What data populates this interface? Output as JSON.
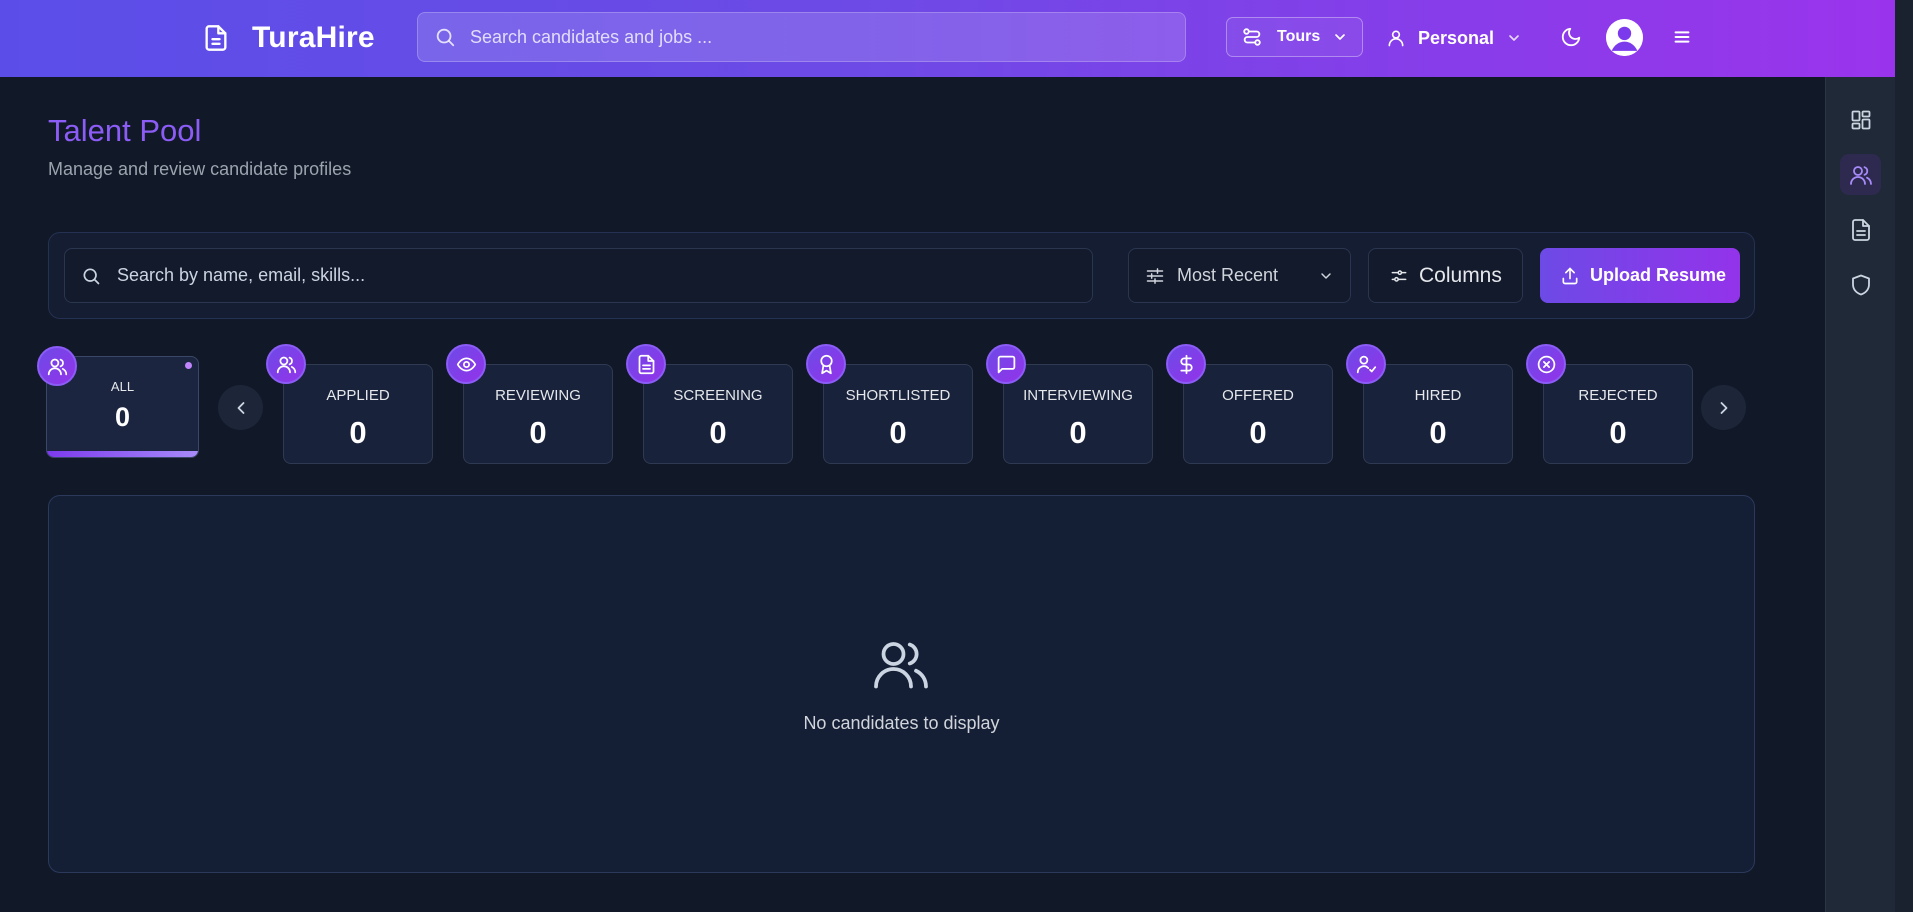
{
  "header": {
    "brand": "TuraHire",
    "search_placeholder": "Search candidates and jobs ...",
    "tours_label": "Tours",
    "workspace_label": "Personal"
  },
  "page": {
    "title": "Talent Pool",
    "subtitle": "Manage and review candidate profiles"
  },
  "toolbar": {
    "search_placeholder": "Search by name, email, skills...",
    "sort_value": "Most Recent",
    "columns_label": "Columns",
    "upload_label": "Upload Resume"
  },
  "statuses": {
    "all": {
      "label": "ALL",
      "count": "0",
      "icon": "users-icon"
    },
    "applied": {
      "label": "APPLIED",
      "count": "0",
      "icon": "users-icon"
    },
    "reviewing": {
      "label": "REVIEWING",
      "count": "0",
      "icon": "eye-icon"
    },
    "screening": {
      "label": "SCREENING",
      "count": "0",
      "icon": "document-icon"
    },
    "shortlisted": {
      "label": "SHORTLISTED",
      "count": "0",
      "icon": "award-icon"
    },
    "interviewing": {
      "label": "INTERVIEWING",
      "count": "0",
      "icon": "message-icon"
    },
    "offered": {
      "label": "OFFERED",
      "count": "0",
      "icon": "dollar-icon"
    },
    "hired": {
      "label": "HIRED",
      "count": "0",
      "icon": "user-check-icon"
    },
    "rejected": {
      "label": "REJECTED",
      "count": "0",
      "icon": "x-circle-icon"
    }
  },
  "empty_state": {
    "message": "No candidates to display",
    "icon": "users-icon"
  },
  "rail": {
    "items": [
      "dashboard-icon",
      "users-icon",
      "document-icon",
      "shield-icon"
    ],
    "active_index": 1
  },
  "colors": {
    "accent": "#8b5cf6",
    "header_gradient_start": "#5b4ee8",
    "header_gradient_end": "#9b34ec",
    "background": "#111827"
  }
}
